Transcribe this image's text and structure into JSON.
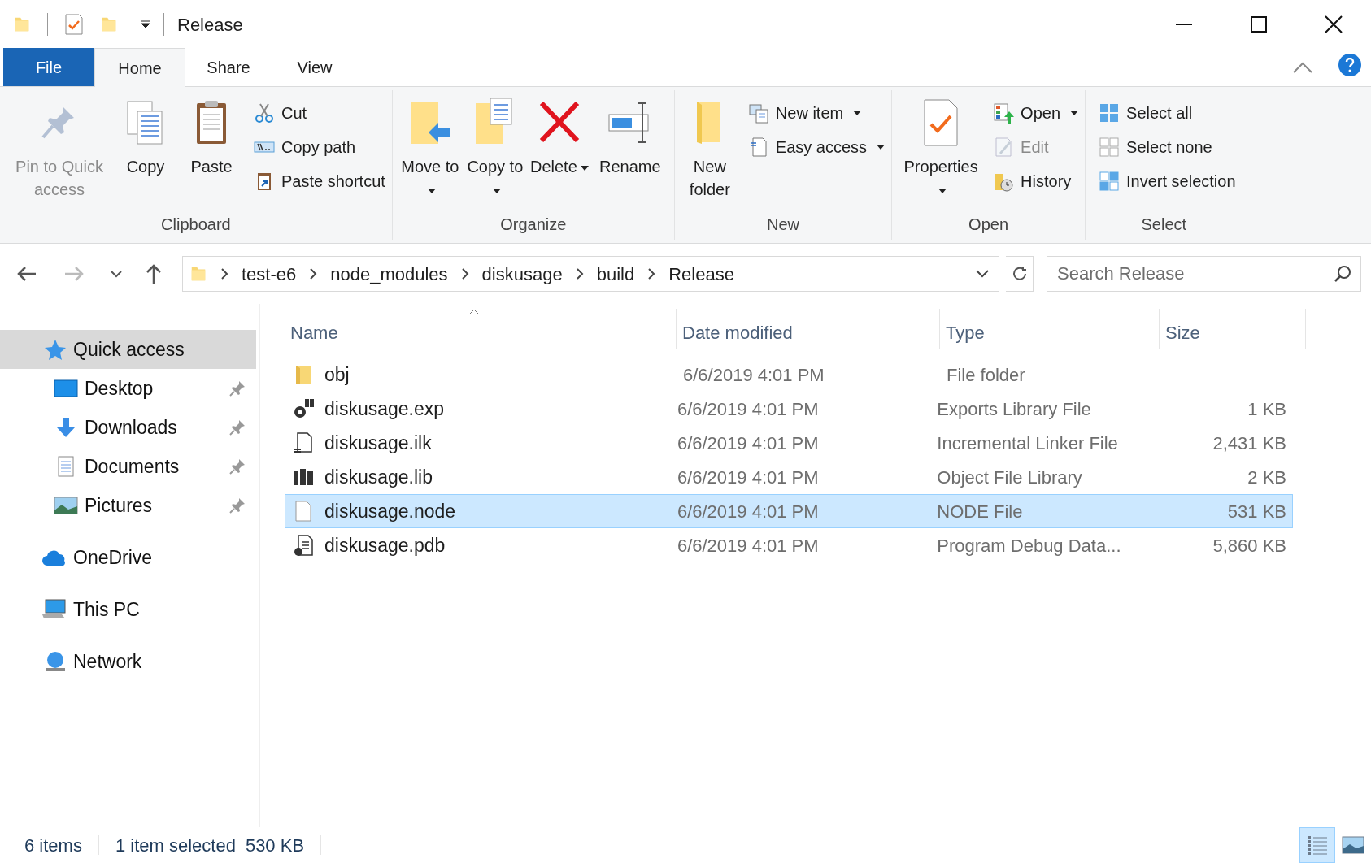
{
  "window": {
    "title": "Release"
  },
  "tabs": [
    {
      "label": "File",
      "kind": "file",
      "selected": false
    },
    {
      "label": "Home",
      "kind": "tab",
      "selected": true
    },
    {
      "label": "Share",
      "kind": "tab",
      "selected": false
    },
    {
      "label": "View",
      "kind": "tab",
      "selected": false
    }
  ],
  "ribbon": {
    "groups": [
      {
        "label": "Clipboard",
        "commands": [
          {
            "label": "Pin to Quick access",
            "kind": "large",
            "disabled": true,
            "dropdown": false
          },
          {
            "label": "Copy",
            "kind": "large",
            "disabled": false,
            "dropdown": false
          },
          {
            "label": "Paste",
            "kind": "large",
            "disabled": false,
            "dropdown": false
          },
          {
            "label": "Cut",
            "kind": "small",
            "disabled": false,
            "dropdown": false
          },
          {
            "label": "Copy path",
            "kind": "small",
            "disabled": false,
            "dropdown": false
          },
          {
            "label": "Paste shortcut",
            "kind": "small",
            "disabled": false,
            "dropdown": false
          }
        ]
      },
      {
        "label": "Organize",
        "commands": [
          {
            "label": "Move to",
            "kind": "large",
            "disabled": false,
            "dropdown": true
          },
          {
            "label": "Copy to",
            "kind": "large",
            "disabled": false,
            "dropdown": true
          },
          {
            "label": "Delete",
            "kind": "large",
            "disabled": false,
            "dropdown": true
          },
          {
            "label": "Rename",
            "kind": "large",
            "disabled": false,
            "dropdown": false
          }
        ]
      },
      {
        "label": "New",
        "commands": [
          {
            "label": "New folder",
            "kind": "large",
            "disabled": false,
            "dropdown": false
          },
          {
            "label": "New item",
            "kind": "small",
            "disabled": false,
            "dropdown": true
          },
          {
            "label": "Easy access",
            "kind": "small",
            "disabled": false,
            "dropdown": true
          }
        ]
      },
      {
        "label": "Open",
        "commands": [
          {
            "label": "Properties",
            "kind": "large",
            "disabled": false,
            "dropdown": true
          },
          {
            "label": "Open",
            "kind": "small",
            "disabled": false,
            "dropdown": true
          },
          {
            "label": "Edit",
            "kind": "small",
            "disabled": true,
            "dropdown": false
          },
          {
            "label": "History",
            "kind": "small",
            "disabled": false,
            "dropdown": false
          }
        ]
      },
      {
        "label": "Select",
        "commands": [
          {
            "label": "Select all",
            "kind": "small",
            "disabled": false,
            "dropdown": false
          },
          {
            "label": "Select none",
            "kind": "small",
            "disabled": false,
            "dropdown": false
          },
          {
            "label": "Invert selection",
            "kind": "small",
            "disabled": false,
            "dropdown": false
          }
        ]
      }
    ]
  },
  "address": {
    "breadcrumbs": [
      "test-e6",
      "node_modules",
      "diskusage",
      "build",
      "Release"
    ],
    "search_placeholder": "Search Release"
  },
  "navigation": [
    {
      "label": "Quick access",
      "kind": "quick",
      "selected": true,
      "children": [
        {
          "label": "Desktop",
          "kind": "desktop",
          "pinned": true,
          "selected": false
        },
        {
          "label": "Downloads",
          "kind": "downloads",
          "pinned": true,
          "selected": false
        },
        {
          "label": "Documents",
          "kind": "documents",
          "pinned": true,
          "selected": false
        },
        {
          "label": "Pictures",
          "kind": "pictures",
          "pinned": true,
          "selected": false
        }
      ]
    },
    {
      "label": "OneDrive",
      "kind": "cloud",
      "selected": false
    },
    {
      "label": "This PC",
      "kind": "pc",
      "selected": false
    },
    {
      "label": "Network",
      "kind": "network",
      "selected": false
    }
  ],
  "file_list": {
    "columns": [
      "Name",
      "Date modified",
      "Type",
      "Size"
    ],
    "rows": [
      {
        "name": "obj",
        "date": "6/6/2019 4:01 PM",
        "type": "File folder",
        "kind": "folder",
        "selected": false
      },
      {
        "name": "diskusage.exp",
        "date": "6/6/2019 4:01 PM",
        "type": "Exports Library File",
        "size": "1 KB",
        "kind": "exp",
        "selected": false
      },
      {
        "name": "diskusage.ilk",
        "date": "6/6/2019 4:01 PM",
        "type": "Incremental Linker File",
        "size": "2,431 KB",
        "kind": "ilk",
        "selected": false
      },
      {
        "name": "diskusage.lib",
        "date": "6/6/2019 4:01 PM",
        "type": "Object File Library",
        "size": "2 KB",
        "kind": "lib",
        "selected": false
      },
      {
        "name": "diskusage.node",
        "date": "6/6/2019 4:01 PM",
        "type": "NODE File",
        "size": "531 KB",
        "kind": "blank",
        "selected": true
      },
      {
        "name": "diskusage.pdb",
        "date": "6/6/2019 4:01 PM",
        "type": "Program Debug Data...",
        "size": "5,860 KB",
        "kind": "pdb",
        "selected": false
      }
    ]
  },
  "status_bar": {
    "item_count": "6 items",
    "selection": "1 item selected",
    "selection_size": "530 KB",
    "views": [
      {
        "kind": "details",
        "selected": true
      },
      {
        "kind": "thumbnails",
        "selected": false
      }
    ]
  }
}
